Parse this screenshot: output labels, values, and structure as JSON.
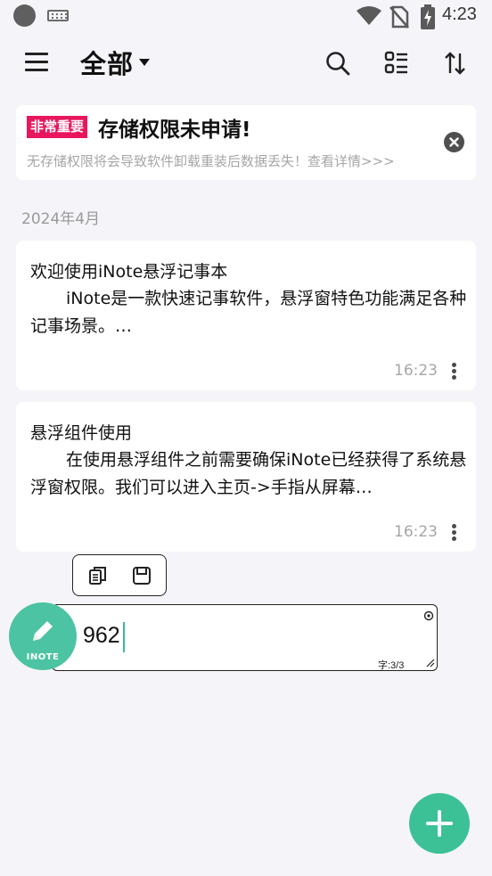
{
  "status_bar": {
    "time": "4:23"
  },
  "app_bar": {
    "title": "全部"
  },
  "warning": {
    "badge": "非常重要",
    "title": "存储权限未申请!",
    "subtitle": "无存储权限将会导致软件卸载重装后数据丢失！查看详情>>>"
  },
  "month_header": "2024年4月",
  "notes": [
    {
      "title": "欢迎使用iNote悬浮记事本",
      "body": "iNote是一款快速记事软件，悬浮窗特色功能满足各种记事场景。…",
      "time": "16:23"
    },
    {
      "title": "悬浮组件使用",
      "body": "在使用悬浮组件之前需要确保iNote已经获得了系统悬浮窗权限。我们可以进入主页->手指从屏幕…",
      "time": "16:23"
    }
  ],
  "float_widget": {
    "input_value": "962",
    "char_count": "字:3/3",
    "ball_label": "INOTE"
  },
  "colors": {
    "accent": "#3cc197",
    "badge": "#e8175d",
    "background": "#f5f5f9"
  }
}
